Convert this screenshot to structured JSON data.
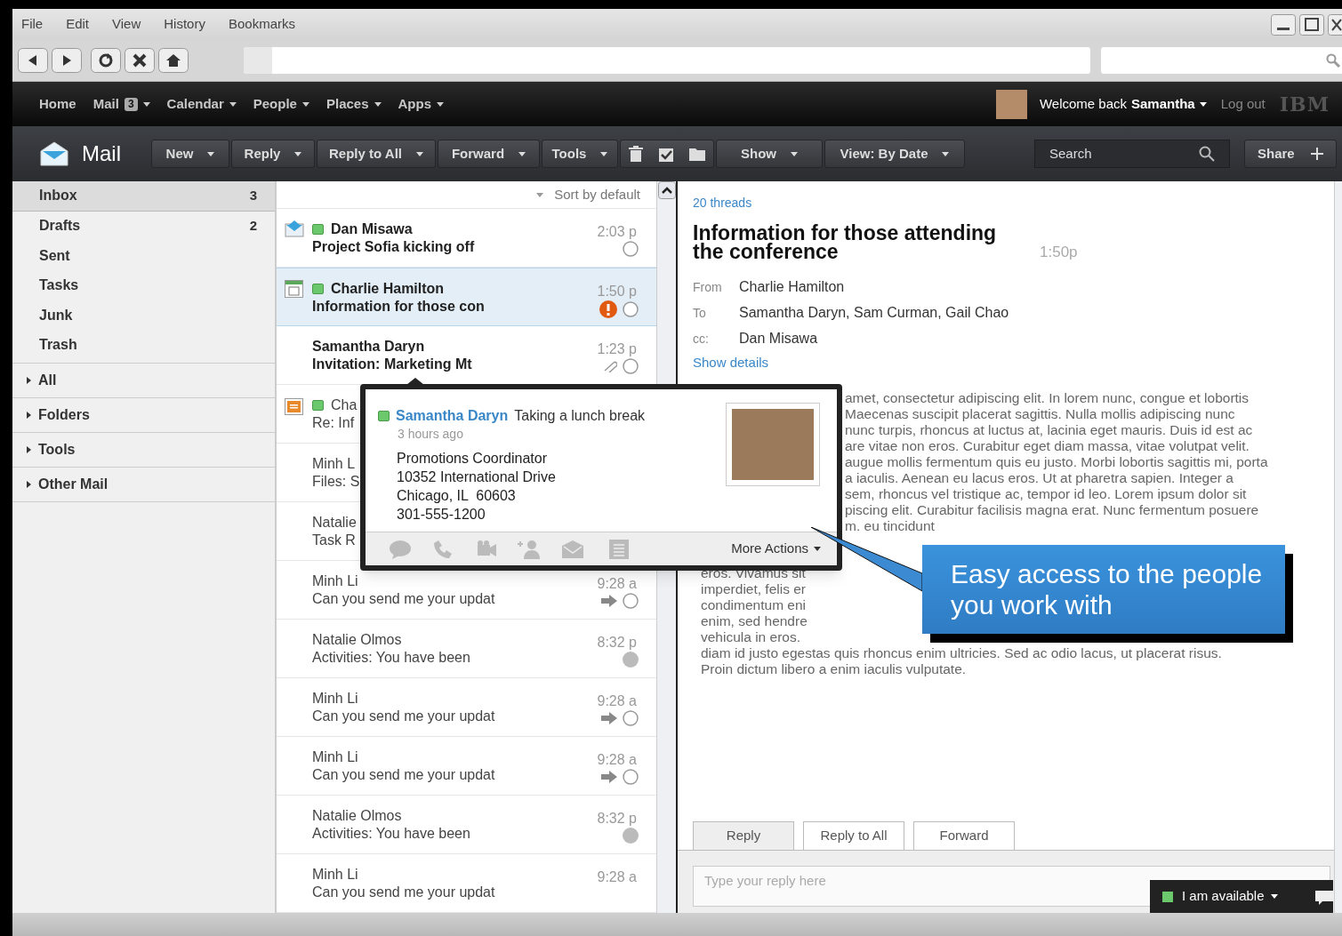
{
  "browser": {
    "menu": [
      "File",
      "Edit",
      "View",
      "History",
      "Bookmarks"
    ]
  },
  "nav": {
    "items": [
      {
        "label": "Home",
        "kind": "link"
      },
      {
        "label": "Mail",
        "badge": "3",
        "kind": "menu"
      },
      {
        "label": "Calendar",
        "kind": "menu"
      },
      {
        "label": "People",
        "kind": "menu"
      },
      {
        "label": "Places",
        "kind": "menu"
      },
      {
        "label": "Apps",
        "kind": "menu"
      }
    ],
    "welcome": "Welcome back",
    "user": "Samantha",
    "logout": "Log out",
    "logo": "IBM"
  },
  "toolbar": {
    "title": "Mail",
    "buttons": [
      "New",
      "Reply",
      "Reply to All",
      "Forward",
      "Tools"
    ],
    "view_buttons": [
      "Show",
      "View: By Date"
    ],
    "search": {
      "placeholder": "Search"
    },
    "share": "Share"
  },
  "sidebar": {
    "folders": [
      {
        "label": "Inbox",
        "count": "3",
        "selected": true
      },
      {
        "label": "Drafts",
        "count": "2",
        "selected": false
      },
      {
        "label": "Sent",
        "selected": false
      },
      {
        "label": "Tasks",
        "selected": false
      },
      {
        "label": "Junk",
        "selected": false
      },
      {
        "label": "Trash",
        "selected": false
      }
    ],
    "sections": [
      "All",
      "Folders",
      "Tools",
      "Other Mail"
    ]
  },
  "list": {
    "sort": "Sort by default",
    "rows": [
      {
        "kind": "reply",
        "online": true,
        "sender": "Dan Misawa",
        "subject": "Project Sofia kicking off",
        "time": "2:03 p",
        "unread": true,
        "selected": false,
        "important": false,
        "attachment": false,
        "forwarded": false,
        "completed": false
      },
      {
        "kind": "calendar",
        "online": true,
        "sender": "Charlie Hamilton",
        "subject": "Information for those con",
        "time": "1:50 p",
        "unread": true,
        "selected": true,
        "important": true,
        "attachment": false,
        "forwarded": false,
        "completed": false
      },
      {
        "kind": "plain",
        "online": false,
        "sender": "Samantha Daryn",
        "subject": "Invitation: Marketing Mt",
        "time": "1:23 p",
        "unread": true,
        "selected": false,
        "important": false,
        "attachment": true,
        "forwarded": false,
        "completed": false
      },
      {
        "kind": "task",
        "online": true,
        "sender": "Cha",
        "subject": "Re: Inf",
        "unread": false,
        "selected": false
      },
      {
        "kind": "plain",
        "online": false,
        "sender": "Minh L",
        "subject": "Files: S",
        "unread": false,
        "selected": false
      },
      {
        "kind": "plain",
        "online": false,
        "sender": "Natalie",
        "subject": "Task R",
        "unread": false,
        "selected": false
      },
      {
        "kind": "plain",
        "online": false,
        "sender": "Minh Li",
        "subject": "Can you send me your updat",
        "time": "9:28 a",
        "unread": false,
        "selected": false,
        "important": false,
        "attachment": false,
        "forwarded": true,
        "completed": false
      },
      {
        "kind": "plain",
        "online": false,
        "sender": "Natalie Olmos",
        "subject": "Activities: You have been",
        "time": "8:32 p",
        "unread": false,
        "selected": false,
        "important": false,
        "attachment": false,
        "forwarded": false,
        "completed": true
      },
      {
        "kind": "plain",
        "online": false,
        "sender": "Minh Li",
        "subject": "Can you send me your updat",
        "time": "9:28 a",
        "unread": false,
        "selected": false,
        "important": false,
        "attachment": false,
        "forwarded": true,
        "completed": false
      },
      {
        "kind": "plain",
        "online": false,
        "sender": "Minh Li",
        "subject": "Can you send me your updat",
        "time": "9:28 a",
        "unread": false,
        "selected": false,
        "important": false,
        "attachment": false,
        "forwarded": true,
        "completed": false
      },
      {
        "kind": "plain",
        "online": false,
        "sender": "Natalie Olmos",
        "subject": "Activities: You have been",
        "time": "8:32 p",
        "unread": false,
        "selected": false,
        "important": false,
        "attachment": false,
        "forwarded": false,
        "completed": true
      },
      {
        "kind": "plain",
        "online": false,
        "sender": "Minh Li",
        "subject": "Can you send me your updat",
        "time": "9:28 a",
        "unread": false,
        "selected": false
      }
    ]
  },
  "reading": {
    "threads": "20 threads",
    "title": "Information for those attending the conference",
    "time": "1:50p",
    "headers": [
      {
        "label": "From",
        "value": "Charlie Hamilton"
      },
      {
        "label": "To",
        "value": "Samantha Daryn, Sam Curman, Gail Chao"
      },
      {
        "label": "cc:",
        "value": "Dan Misawa"
      }
    ],
    "show_details": "Show details",
    "body_beside_card": [
      "amet, consectetur adipiscing elit. In lorem nunc, congue et lobortis",
      "Maecenas suscipit placerat sagittis. Nulla mollis adipiscing nunc",
      "nunc turpis, rhoncus at luctus at, lacinia eget mauris. Duis id est ac",
      "are vitae non eros. Curabitur eget diam massa, vitae volutpat velit.",
      "augue mollis fermentum quis eu justo. Morbi lobortis sagittis mi, porta",
      "a iaculis. Aenean eu lacus eros. Ut at pharetra sapien. Integer a",
      "sem, rhoncus vel tristique ac, tempor id leo. Lorem ipsum dolor sit",
      "piscing elit. Curabitur facilisis magna erat. Nunc fermentum posuere",
      "m. eu tincidunt"
    ],
    "body_beside_callout": [
      "eros. Vivamus sit",
      "imperdiet, felis er",
      "condimentum eni",
      "enim, sed hendre",
      "vehicula in eros."
    ],
    "body_lines": [
      "diam id justo egestas quis rhoncus enim ultricies. Sed ac odio lacus, ut placerat risus.",
      "Proin dictum libero a enim iaculis vulputate."
    ],
    "reply_tabs": [
      {
        "label": "Reply",
        "selected": true
      },
      {
        "label": "Reply to All",
        "selected": false
      },
      {
        "label": "Forward",
        "selected": false
      }
    ],
    "reply": {
      "placeholder": "Type your reply here"
    }
  },
  "business_card": {
    "online": true,
    "name": "Samantha Daryn",
    "status": "Taking a lunch break",
    "ago": "3 hours ago",
    "details": [
      "Promotions Coordinator",
      "10352 International Drive",
      "Chicago, IL  60603",
      "301-555-1200"
    ],
    "more": "More Actions"
  },
  "callout": "Easy access to the people you work with",
  "chat": {
    "online": true,
    "status": "I am available"
  }
}
